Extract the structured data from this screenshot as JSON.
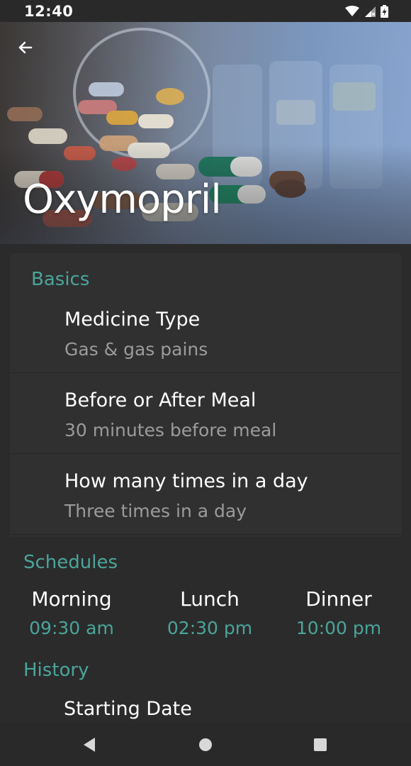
{
  "status_bar": {
    "time": "12:40",
    "icons": [
      "wifi-icon",
      "signal-icon",
      "battery-charging-icon"
    ]
  },
  "header": {
    "back_icon": "arrow-left-icon",
    "title": "Oxymopril"
  },
  "basics": {
    "section_label": "Basics",
    "items": [
      {
        "title": "Medicine Type",
        "value": "Gas & gas pains"
      },
      {
        "title": "Before or After Meal",
        "value": "30 minutes before meal"
      },
      {
        "title": "How many times in a day",
        "value": "Three times in a day"
      }
    ]
  },
  "schedules": {
    "section_label": "Schedules",
    "items": [
      {
        "name": "Morning",
        "time": "09:30 am"
      },
      {
        "name": "Lunch",
        "time": "02:30 pm"
      },
      {
        "name": "Dinner",
        "time": "10:00 pm"
      }
    ]
  },
  "history": {
    "section_label": "History",
    "items": [
      {
        "title": "Starting Date"
      }
    ]
  },
  "nav_bar": {
    "icons": [
      "back-triangle-icon",
      "home-circle-icon",
      "recents-square-icon"
    ]
  },
  "colors": {
    "accent": "#4aa59a",
    "background": "#2b2b2b",
    "card": "#303030"
  }
}
